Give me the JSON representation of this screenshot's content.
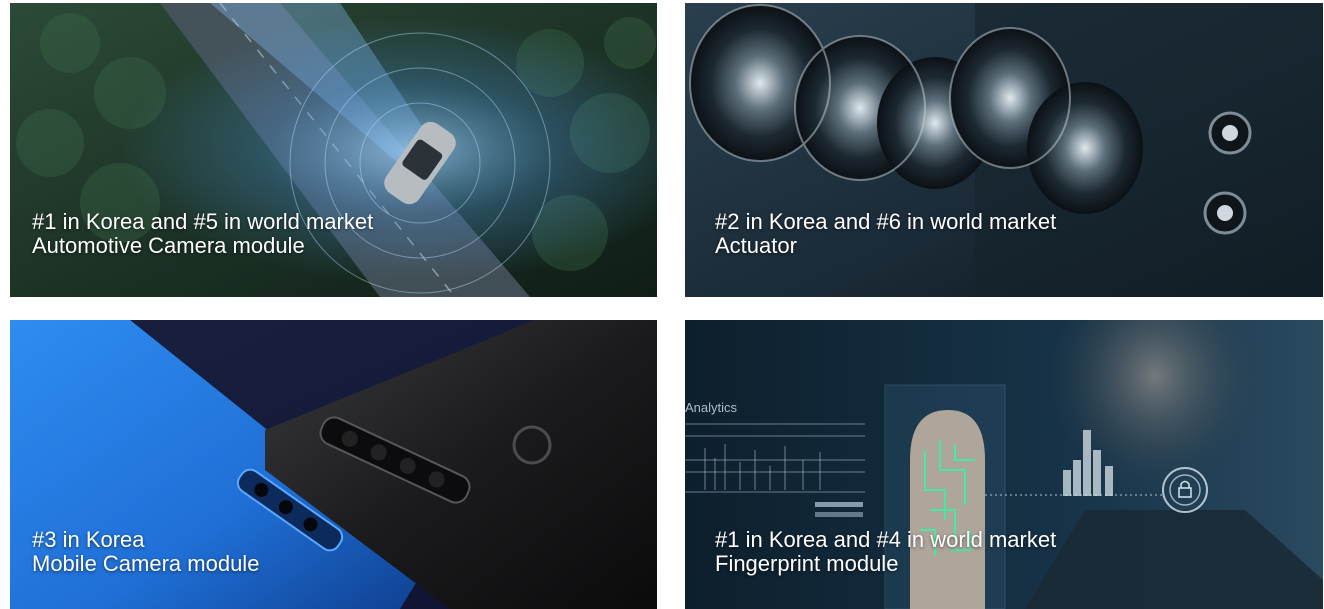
{
  "panels": [
    {
      "id": "automotive",
      "line1": "#1 in Korea and #5 in world market",
      "line2": "Automotive Camera module",
      "icon": "car-icon"
    },
    {
      "id": "actuator",
      "line1": "#2 in Korea and #6 in world market",
      "line2": "Actuator",
      "icon": "lens-icon"
    },
    {
      "id": "mobile",
      "line1": "#3 in Korea",
      "line2": "Mobile Camera module",
      "icon": "smartphone-icon"
    },
    {
      "id": "fingerprint",
      "line1": "#1 in Korea and  #4 in world market",
      "line2": "Fingerprint module",
      "icon": "fingerprint-icon",
      "overlay_label": "Analytics"
    }
  ],
  "colors": {
    "caption_text": "#ffffff",
    "forest_dark": "#1d3326",
    "lens_dark": "#1a2a36",
    "phone_blue": "#1f6fd6",
    "phone_black": "#1b1b1d",
    "tech_dark": "#0d1f2c",
    "scan_glow": "#3cf0a0"
  }
}
